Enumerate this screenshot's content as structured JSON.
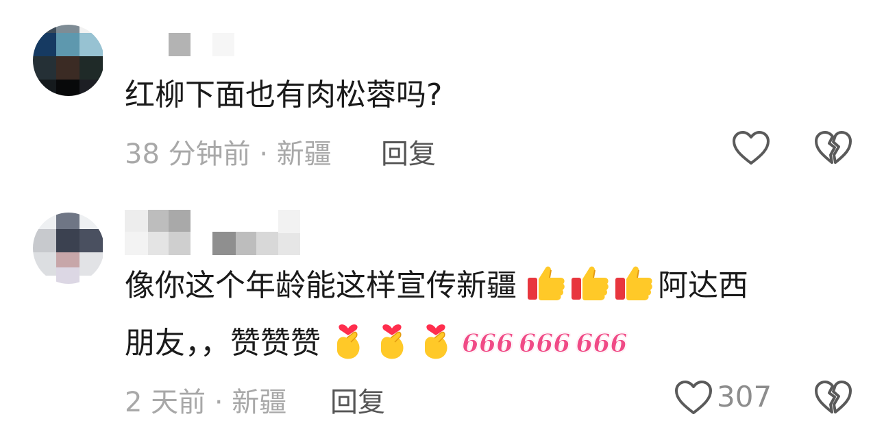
{
  "comments": [
    {
      "text": "红柳下面也有肉松蓉吗?",
      "time_location": "38 分钟前 · 新疆",
      "reply_label": "回复",
      "like_count": ""
    },
    {
      "text_line1": "像你这个年龄能这样宣传新疆",
      "text_after_thumbs": "阿达西",
      "text_line2": "朋友，，赞赞赞",
      "six_labels": [
        "666",
        "666",
        "666"
      ],
      "time_location": "2 天前 · 新疆",
      "reply_label": "回复",
      "like_count": "307"
    }
  ],
  "colors": {
    "text": "#1a1a1a",
    "meta": "#a8a8a8",
    "reply": "#555555",
    "icon_stroke": "#5a5a5a",
    "six": "#f04a86"
  },
  "icons": [
    "heart-outline-icon",
    "broken-heart-icon",
    "thumbs-up-emoji",
    "finger-heart-emoji"
  ]
}
